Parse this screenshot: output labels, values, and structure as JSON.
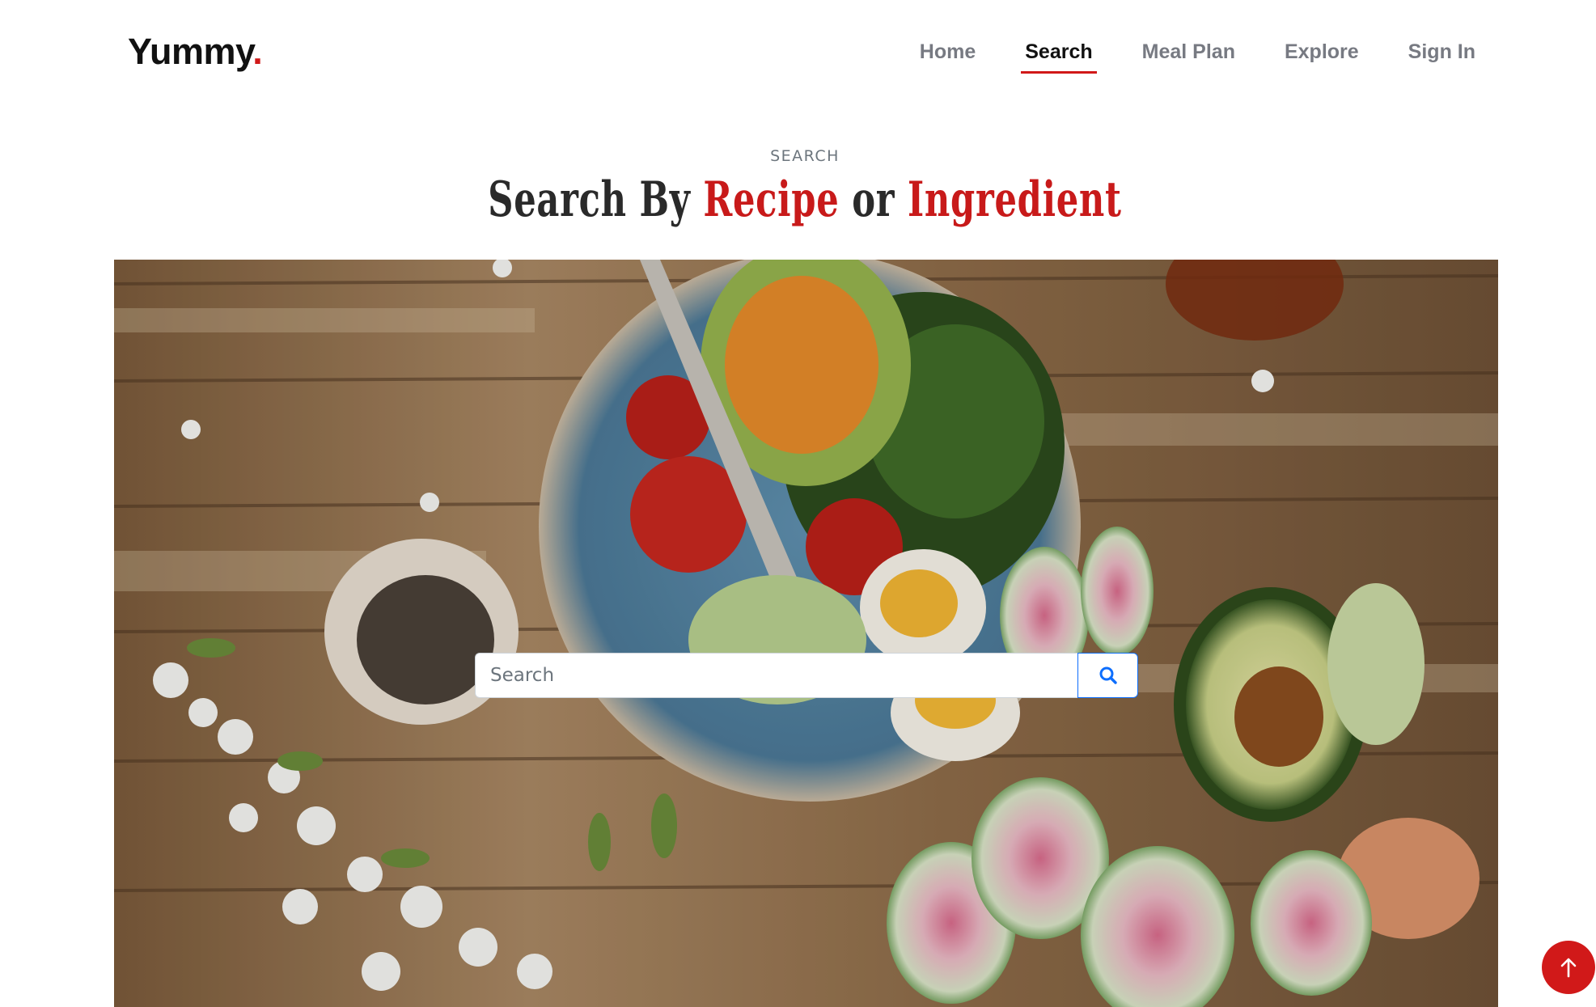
{
  "header": {
    "logo_text": "Yummy",
    "logo_dot": ".",
    "nav": [
      {
        "label": "Home",
        "active": false
      },
      {
        "label": "Search",
        "active": true
      },
      {
        "label": "Meal Plan",
        "active": false
      },
      {
        "label": "Explore",
        "active": false
      },
      {
        "label": "Sign In",
        "active": false
      }
    ]
  },
  "section": {
    "kicker": "SEARCH",
    "title_part1": "Search By ",
    "title_accent1": "Recipe",
    "title_part2": " or ",
    "title_accent2": "Ingredient"
  },
  "search": {
    "placeholder": "Search",
    "value": "",
    "button_icon": "search-icon"
  },
  "scroll_top": {
    "icon": "arrow-up-icon"
  },
  "colors": {
    "brand_red": "#d11919",
    "accent_blue": "#0d6efd",
    "nav_inactive": "#777a82",
    "text_dark": "#111111"
  }
}
